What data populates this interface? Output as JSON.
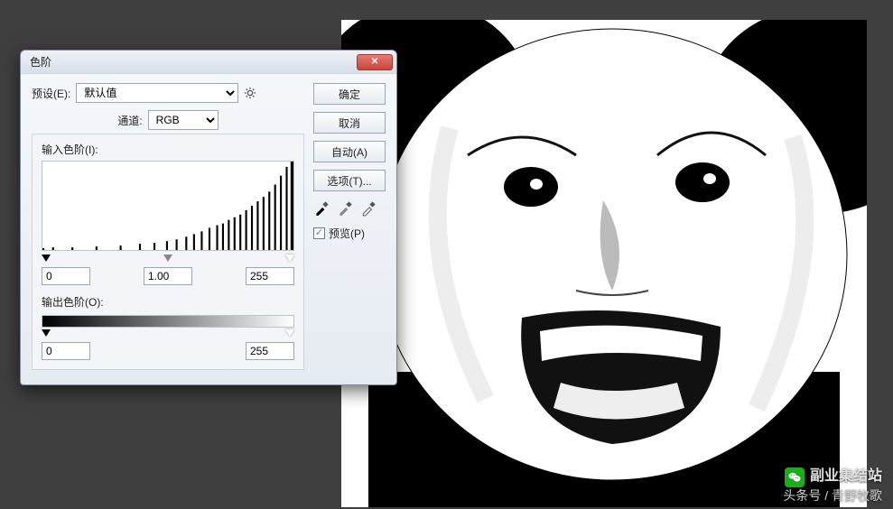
{
  "dialog": {
    "title": "色阶",
    "preset_label": "预设(E):",
    "preset_value": "默认值",
    "channel_label": "通道:",
    "channel_value": "RGB",
    "input_levels_label": "输入色阶(I):",
    "output_levels_label": "输出色阶(O):",
    "input": {
      "black": "0",
      "gamma": "1.00",
      "white": "255"
    },
    "output": {
      "black": "0",
      "white": "255"
    }
  },
  "buttons": {
    "ok": "确定",
    "cancel": "取消",
    "auto": "自动(A)",
    "options": "选项(T)...",
    "preview": "预览(P)"
  },
  "watermark": {
    "main": "副业集结站",
    "sub": "头条号 / 青野牧歌"
  }
}
